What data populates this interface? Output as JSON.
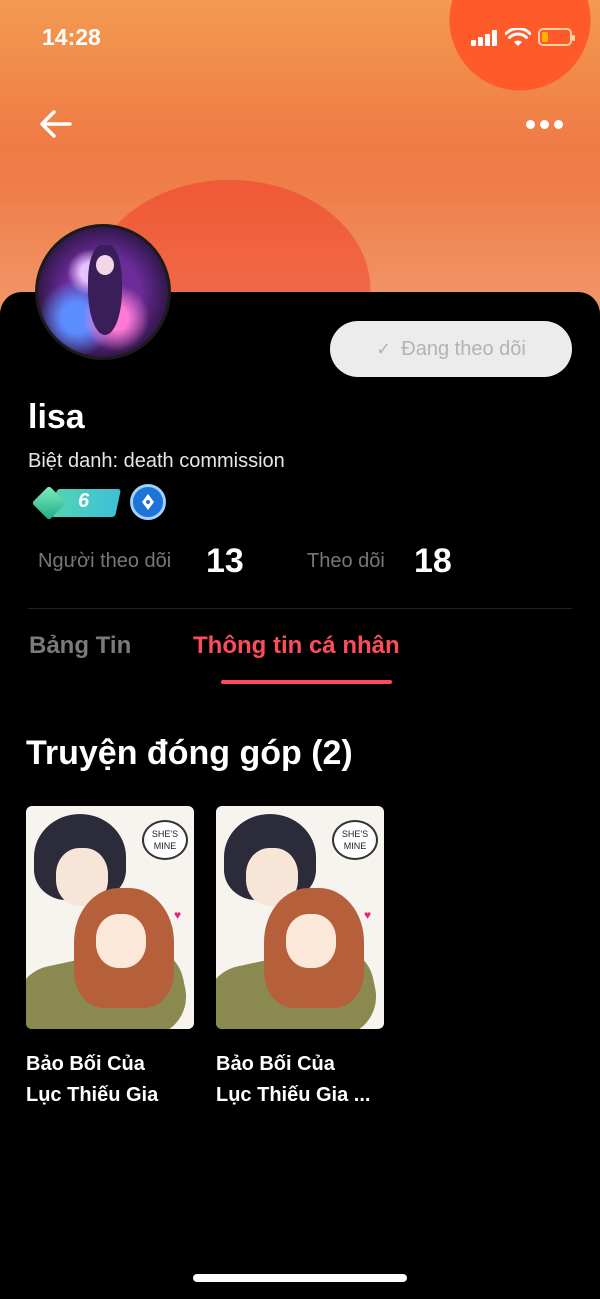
{
  "status_bar": {
    "time": "14:28",
    "battery_level": 0.22
  },
  "profile": {
    "username": "lisa",
    "nickname_label": "Biệt danh: death commission",
    "level": "6",
    "follow_button_label": "Đang theo dõi",
    "followers_label": "Người theo dõi",
    "followers_count": "13",
    "following_label": "Theo dõi",
    "following_count": "18"
  },
  "tabs": [
    {
      "label": "Bảng Tin",
      "active": false
    },
    {
      "label": "Thông tin cá nhân",
      "active": true
    }
  ],
  "section": {
    "title": "Truyện đóng góp (2)"
  },
  "books": [
    {
      "title": "Bảo Bối Của\nLục Thiếu Gia",
      "bubble_text": "SHE'S MINE"
    },
    {
      "title": "Bảo Bối Của\nLục Thiếu Gia ...",
      "bubble_text": "SHE'S MINE"
    }
  ],
  "colors": {
    "accent": "#ff4b5c",
    "follow_bg": "#ececec",
    "header_gradient_start": "#f39a52",
    "header_gradient_end": "#ef7a45"
  },
  "icons": {
    "back": "arrow-left-icon",
    "more": "more-dots-icon",
    "check": "check-icon",
    "pen": "pen-icon"
  }
}
